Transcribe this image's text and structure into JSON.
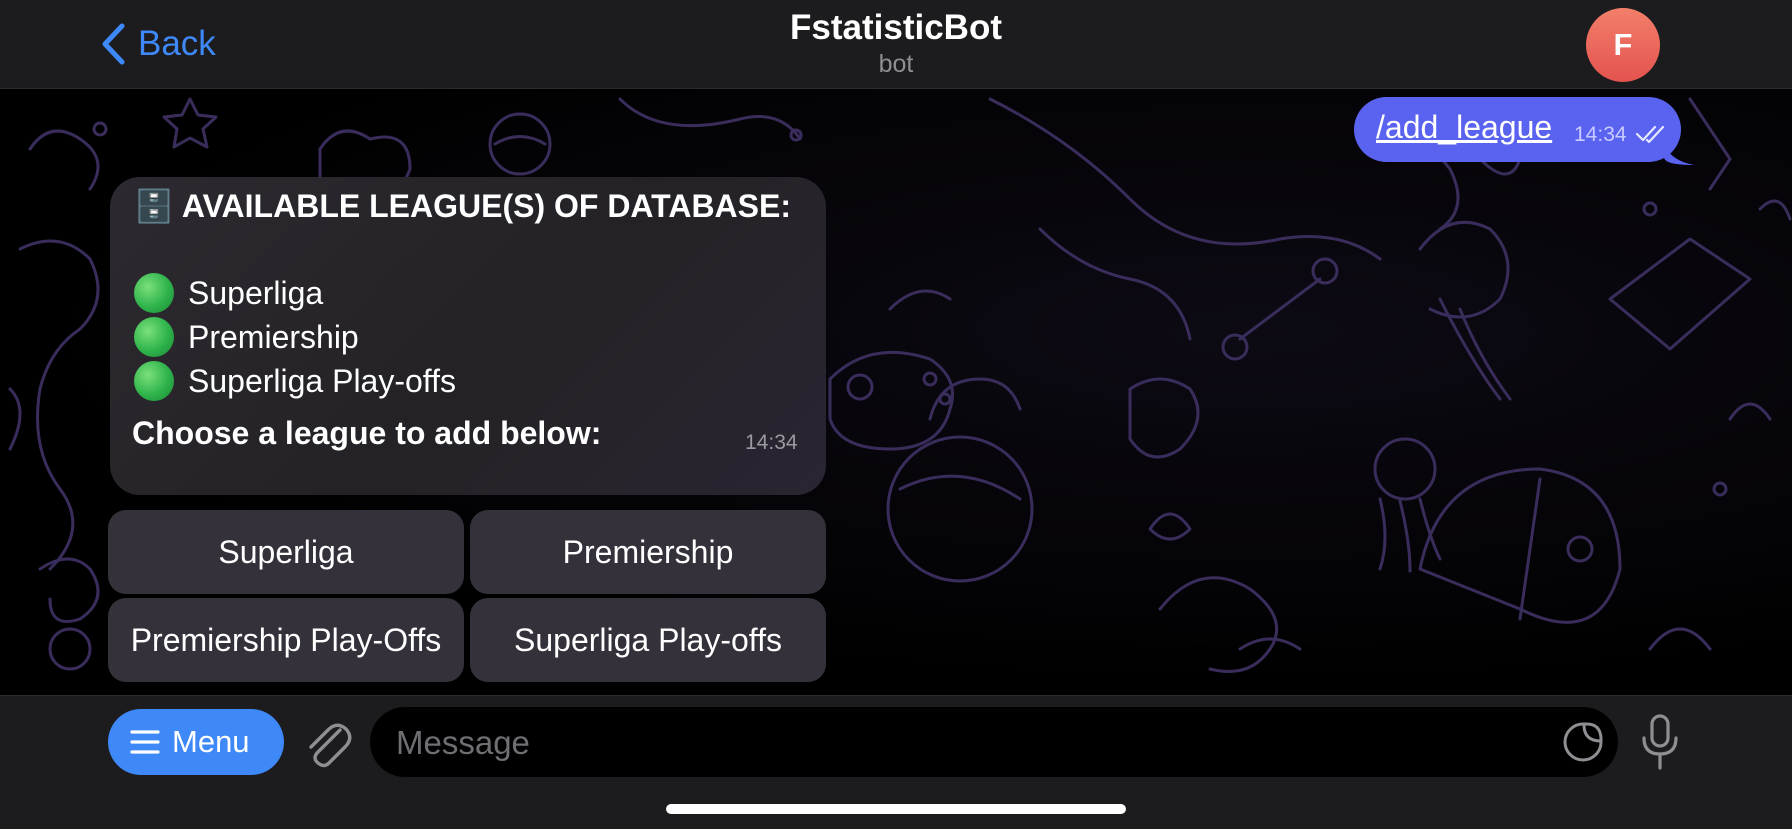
{
  "header": {
    "back_label": "Back",
    "title": "FstatisticBot",
    "subtitle": "bot",
    "avatar_letter": "F",
    "accent_color": "#3e88f7"
  },
  "messages": {
    "outgoing": {
      "text": "/add_league",
      "time": "14:34",
      "status": "read"
    },
    "incoming": {
      "heading_icon": "🗄️",
      "heading": "AVAILABLE LEAGUE(S) OF DATABASE:",
      "leagues": [
        "Superliga",
        "Premiership",
        "Superliga Play-offs"
      ],
      "prompt": "Choose a league to add below:",
      "time": "14:34"
    }
  },
  "keyboard": {
    "buttons": [
      "Superliga",
      "Premiership",
      "Premiership Play-Offs",
      "Superliga Play-offs"
    ]
  },
  "bottom_bar": {
    "menu_label": "Menu",
    "message_placeholder": "Message"
  }
}
